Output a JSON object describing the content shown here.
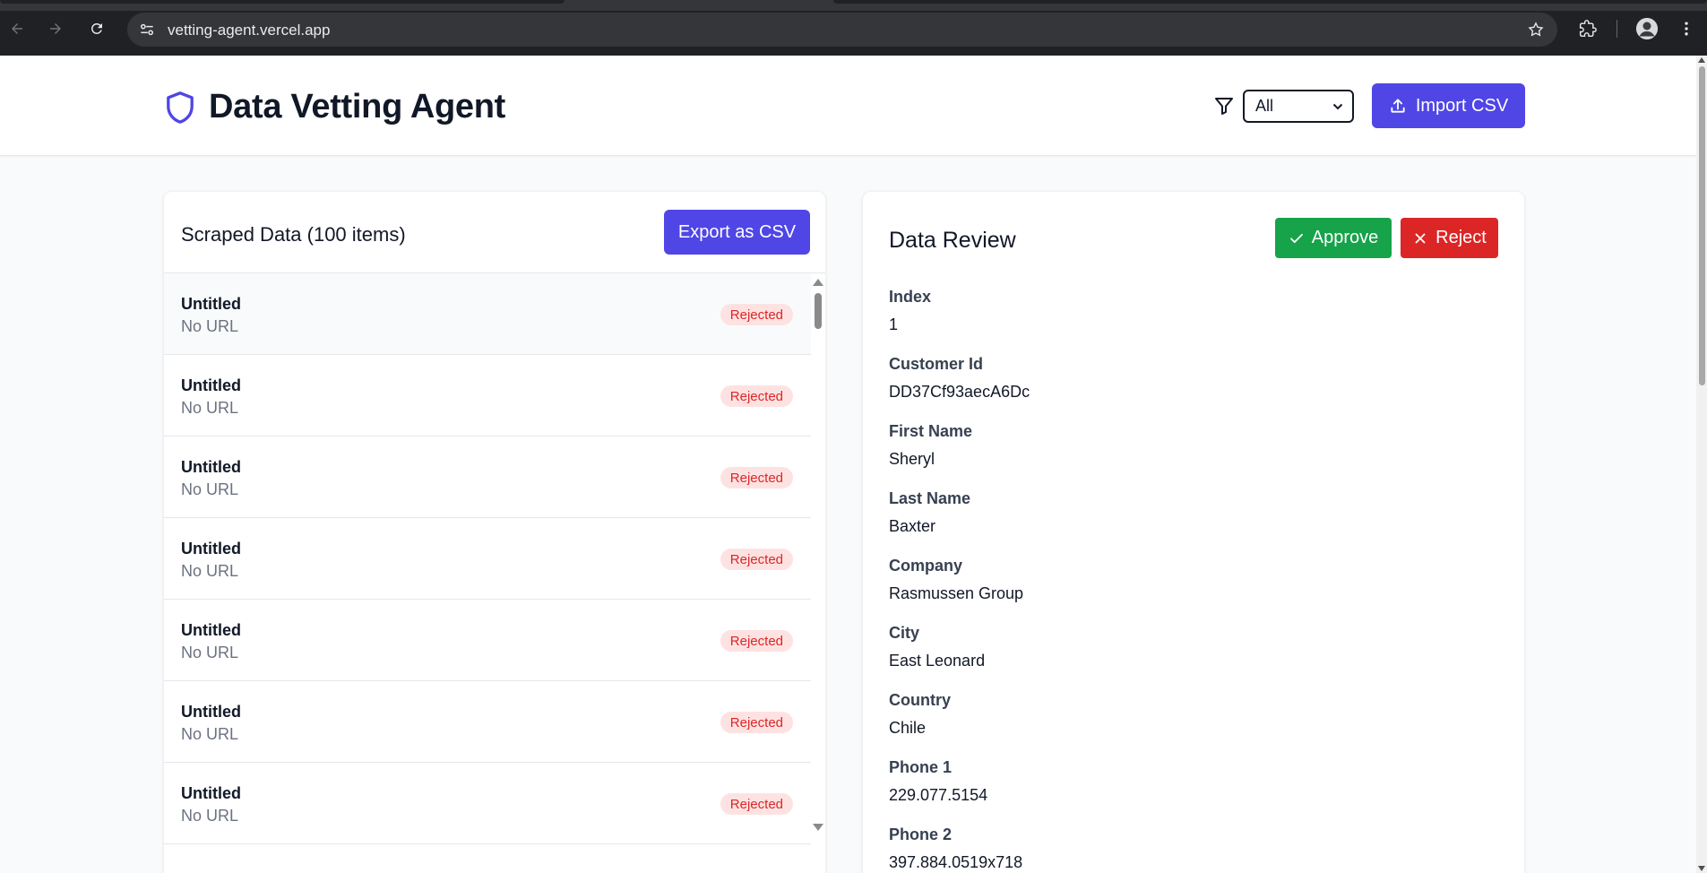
{
  "browser": {
    "url": "vetting-agent.vercel.app"
  },
  "header": {
    "title": "Data Vetting Agent",
    "filter": {
      "selected": "All"
    },
    "import_label": "Import CSV"
  },
  "left": {
    "title": "Scraped Data (100 items)",
    "export_label": "Export as CSV",
    "items": [
      {
        "title": "Untitled",
        "url": "No URL",
        "status": "Rejected"
      },
      {
        "title": "Untitled",
        "url": "No URL",
        "status": "Rejected"
      },
      {
        "title": "Untitled",
        "url": "No URL",
        "status": "Rejected"
      },
      {
        "title": "Untitled",
        "url": "No URL",
        "status": "Rejected"
      },
      {
        "title": "Untitled",
        "url": "No URL",
        "status": "Rejected"
      },
      {
        "title": "Untitled",
        "url": "No URL",
        "status": "Rejected"
      },
      {
        "title": "Untitled",
        "url": "No URL",
        "status": "Rejected"
      }
    ]
  },
  "review": {
    "title": "Data Review",
    "approve_label": "Approve",
    "reject_label": "Reject",
    "fields": [
      {
        "label": "Index",
        "value": "1"
      },
      {
        "label": "Customer Id",
        "value": "DD37Cf93aecA6Dc"
      },
      {
        "label": "First Name",
        "value": "Sheryl"
      },
      {
        "label": "Last Name",
        "value": "Baxter"
      },
      {
        "label": "Company",
        "value": "Rasmussen Group"
      },
      {
        "label": "City",
        "value": "East Leonard"
      },
      {
        "label": "Country",
        "value": "Chile"
      },
      {
        "label": "Phone 1",
        "value": "229.077.5154"
      },
      {
        "label": "Phone 2",
        "value": "397.884.0519x718"
      }
    ]
  },
  "colors": {
    "primary": "#4f46e5",
    "approve": "#16a34a",
    "reject": "#dc2626",
    "badge_bg": "#fee2e2"
  }
}
